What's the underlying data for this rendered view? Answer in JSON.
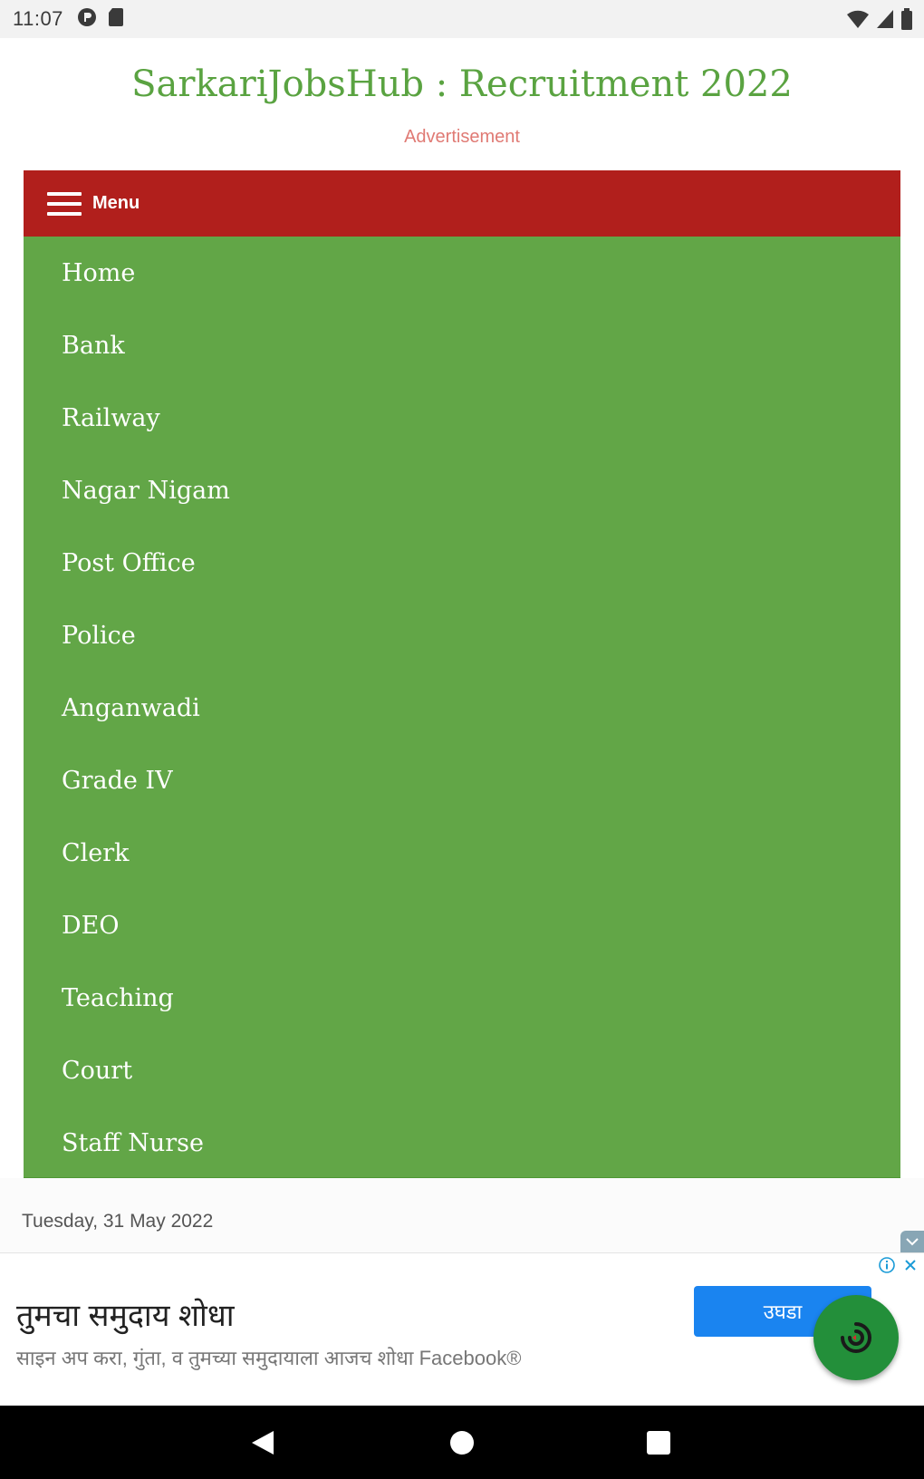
{
  "status_bar": {
    "time": "11:07",
    "icons": [
      "data-saver-icon",
      "sd-card-icon",
      "wifi-icon",
      "signal-icon",
      "battery-icon"
    ]
  },
  "header": {
    "site_title": "SarkariJobsHub : Recruitment 2022",
    "ad_label": "Advertisement"
  },
  "menu": {
    "label": "Menu",
    "items": [
      {
        "label": "Home"
      },
      {
        "label": "Bank"
      },
      {
        "label": "Railway"
      },
      {
        "label": "Nagar Nigam"
      },
      {
        "label": "Post Office"
      },
      {
        "label": "Police"
      },
      {
        "label": "Anganwadi"
      },
      {
        "label": "Grade IV"
      },
      {
        "label": "Clerk"
      },
      {
        "label": "DEO"
      },
      {
        "label": "Teaching"
      },
      {
        "label": "Court"
      },
      {
        "label": "Staff Nurse"
      }
    ]
  },
  "date_text": "Tuesday, 31 May 2022",
  "ad": {
    "title": "तुमचा समुदाय शोधा",
    "subtitle": "साइन अप करा, गुंता, व तुमच्या समुदायाला आजच शोधा Facebook®",
    "cta": "उघडा"
  },
  "colors": {
    "title_green": "#5aa341",
    "menu_bar_red": "#b11f1c",
    "menu_green": "#62a647",
    "ad_label_pink": "#e07a74",
    "cta_blue": "#1a84f0",
    "fab_green": "#238f3a"
  }
}
